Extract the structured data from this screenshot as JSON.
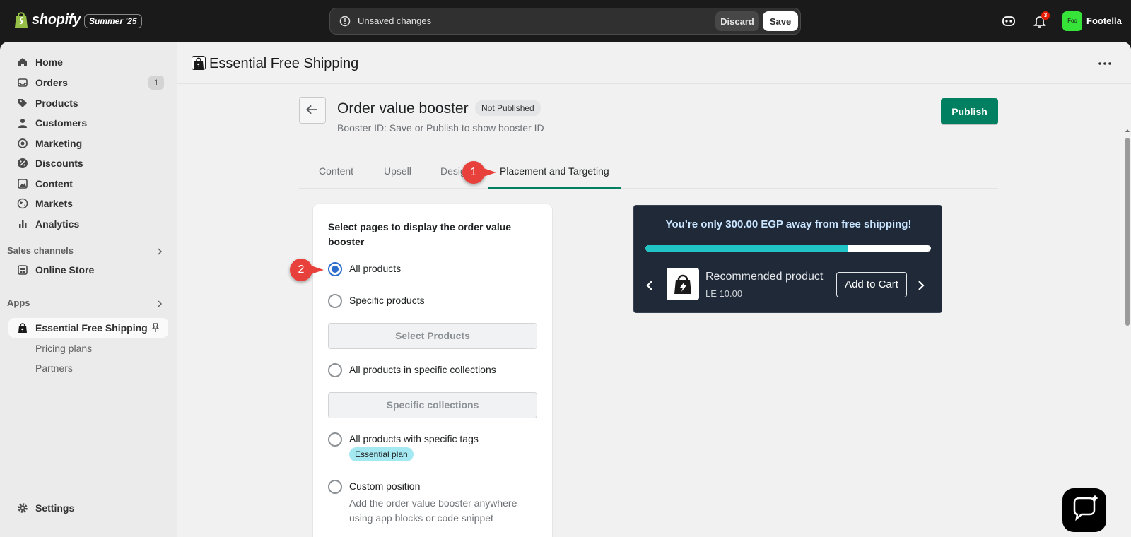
{
  "topbar": {
    "brand": "shopify",
    "edition": "Summer '25",
    "unsaved_text": "Unsaved changes",
    "discard_label": "Discard",
    "save_label": "Save",
    "notification_count": "3",
    "avatar_initials": "Foo",
    "store_name": "Footella"
  },
  "sidebar": {
    "items": [
      {
        "label": "Home",
        "icon": "home-icon"
      },
      {
        "label": "Orders",
        "icon": "orders-icon",
        "count": "1"
      },
      {
        "label": "Products",
        "icon": "tag-icon"
      },
      {
        "label": "Customers",
        "icon": "person-icon"
      },
      {
        "label": "Marketing",
        "icon": "target-icon"
      },
      {
        "label": "Discounts",
        "icon": "discount-icon"
      },
      {
        "label": "Content",
        "icon": "image-icon"
      },
      {
        "label": "Markets",
        "icon": "globe-icon"
      },
      {
        "label": "Analytics",
        "icon": "bar-chart-icon"
      }
    ],
    "sales_channels_title": "Sales channels",
    "online_store": "Online Store",
    "apps_title": "Apps",
    "app_name": "Essential Free Shipping",
    "app_subitems": [
      "Pricing plans",
      "Partners"
    ],
    "settings": "Settings"
  },
  "app_header": {
    "title": "Essential Free Shipping"
  },
  "page": {
    "title": "Order value booster",
    "status": "Not Published",
    "subtitle": "Booster ID: Save or Publish to show booster ID",
    "publish_label": "Publish",
    "tabs": [
      "Content",
      "Upsell",
      "Design",
      "Placement and Targeting"
    ],
    "active_tab": "Placement and Targeting"
  },
  "targeting_card": {
    "title": "Select pages to display the order value booster",
    "options": [
      "All products",
      "Specific products",
      "All products in specific collections",
      "All products with specific tags",
      "Custom position"
    ],
    "selected": "All products",
    "select_products_label": "Select Products",
    "specific_collections_label": "Specific collections",
    "plan_badge": "Essential plan",
    "custom_help": "Add the order value booster anywhere using app blocks or code snippet"
  },
  "preview": {
    "message": "You’re only 300.00 EGP away from free shipping!",
    "progress_fraction": 0.71,
    "product_name": "Recommended product",
    "product_price": "LE 10.00",
    "add_to_cart": "Add to Cart"
  },
  "annotations": {
    "marker_1": "1",
    "marker_2": "2"
  },
  "colors": {
    "primary_green": "#008060",
    "radio_blue": "#2c6ecb",
    "progress_teal": "#21c4c4",
    "marker_red": "#e8413c"
  }
}
